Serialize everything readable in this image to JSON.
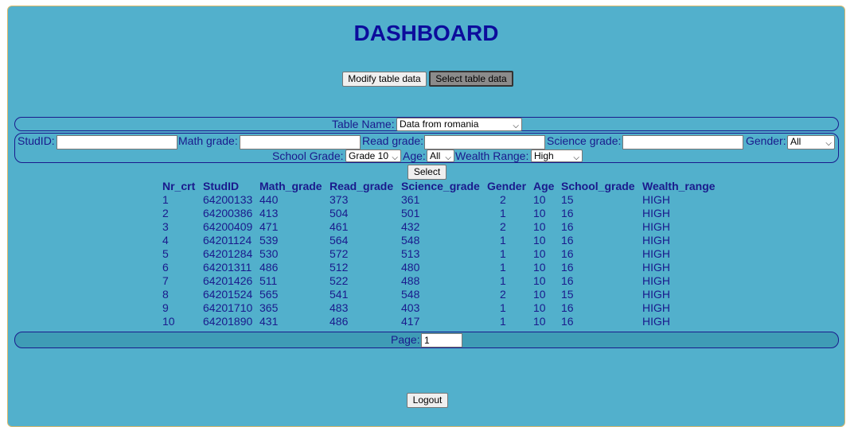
{
  "title": "DASHBOARD",
  "tabs": {
    "modify": "Modify table data",
    "select": "Select table data"
  },
  "table_name": {
    "label": "Table Name:",
    "value": "Data from romania"
  },
  "filters": {
    "studid_label": "StudID:",
    "studid_value": "",
    "math_label": "Math grade:",
    "math_value": "",
    "read_label": "Read grade:",
    "read_value": "",
    "science_label": "Science grade:",
    "science_value": "",
    "gender_label": "Gender:",
    "gender_value": "All",
    "school_label": "School Grade:",
    "school_value": "Grade 10",
    "age_label": "Age:",
    "age_value": "All",
    "wealth_label": "Wealth Range:",
    "wealth_value": "High"
  },
  "select_button": "Select",
  "table": {
    "columns": [
      "Nr_crt",
      "StudID",
      "Math_grade",
      "Read_grade",
      "Science_grade",
      "Gender",
      "Age",
      "School_grade",
      "Wealth_range"
    ],
    "rows": [
      [
        "1",
        "64200133",
        "440",
        "373",
        "361",
        "2",
        "10",
        "15",
        "HIGH"
      ],
      [
        "2",
        "64200386",
        "413",
        "504",
        "501",
        "1",
        "10",
        "16",
        "HIGH"
      ],
      [
        "3",
        "64200409",
        "471",
        "461",
        "432",
        "2",
        "10",
        "16",
        "HIGH"
      ],
      [
        "4",
        "64201124",
        "539",
        "564",
        "548",
        "1",
        "10",
        "16",
        "HIGH"
      ],
      [
        "5",
        "64201284",
        "530",
        "572",
        "513",
        "1",
        "10",
        "16",
        "HIGH"
      ],
      [
        "6",
        "64201311",
        "486",
        "512",
        "480",
        "1",
        "10",
        "16",
        "HIGH"
      ],
      [
        "7",
        "64201426",
        "511",
        "522",
        "488",
        "1",
        "10",
        "16",
        "HIGH"
      ],
      [
        "8",
        "64201524",
        "565",
        "541",
        "548",
        "2",
        "10",
        "15",
        "HIGH"
      ],
      [
        "9",
        "64201710",
        "365",
        "483",
        "403",
        "1",
        "10",
        "16",
        "HIGH"
      ],
      [
        "10",
        "64201890",
        "431",
        "486",
        "417",
        "1",
        "10",
        "16",
        "HIGH"
      ]
    ]
  },
  "page": {
    "label": "Page:",
    "value": "1"
  },
  "logout": "Logout"
}
